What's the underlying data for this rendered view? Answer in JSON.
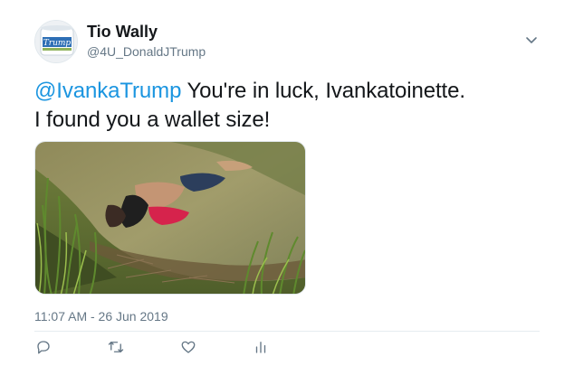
{
  "user": {
    "display_name": "Tio Wally",
    "handle": "@4U_DonaldJTrump",
    "avatar_text": "Trump",
    "avatar_icon": "toilet-paper-avatar"
  },
  "tweet": {
    "mention": "@IvankaTrump",
    "line1_rest": " You're in luck, Ivankatoinette.",
    "line2": "I found you a wallet size!",
    "timestamp": "11:07 AM - 26 Jun 2019"
  },
  "media": {
    "kind": "photo",
    "content": "riverbank-photo"
  },
  "actions": [
    {
      "icon": "reply-icon"
    },
    {
      "icon": "retweet-icon"
    },
    {
      "icon": "like-icon"
    },
    {
      "icon": "analytics-icon"
    }
  ],
  "colors": {
    "link": "#1b95e0",
    "muted": "#657786",
    "text": "#14171a",
    "icon": "#657786"
  }
}
